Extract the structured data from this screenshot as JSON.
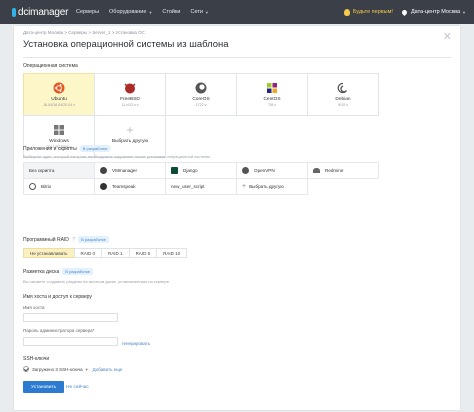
{
  "topbar": {
    "logo_text": "dcimanager",
    "nav": [
      {
        "label": "Серверы",
        "caret": false
      },
      {
        "label": "Оборудование",
        "caret": true
      },
      {
        "label": "Стойки",
        "caret": false
      },
      {
        "label": "Сети",
        "caret": true
      }
    ],
    "wishes_label": "Будьте первым!",
    "datacenter_label": "Дата-центр Москва",
    "colors": {
      "bg": "#3a3f48",
      "accent": "#2fb4e9",
      "wish": "#f7c948"
    }
  },
  "page": {
    "breadcrumb": "Дата-центр Москва  >  Серверы  >  Server_1  >  Установка ОС",
    "title": "Установка операционной системы из шаблона"
  },
  "os_section": {
    "label": "Операционная система",
    "items": [
      {
        "name": "Ubuntu",
        "version": "16.04/18.04/20.04 v",
        "icon": "ubuntu-icon",
        "selected": true
      },
      {
        "name": "FreeBSD",
        "version": "11.x/12.x v",
        "icon": "freebsd-icon",
        "selected": false
      },
      {
        "name": "CoreOS",
        "version": "1722 v",
        "icon": "coreos-icon",
        "selected": false
      },
      {
        "name": "CentOS",
        "version": "7/8 v",
        "icon": "centos-icon",
        "selected": false
      },
      {
        "name": "Debian",
        "version": "9/10 v",
        "icon": "debian-icon",
        "selected": false
      },
      {
        "name": "Windows",
        "version": "2012 R2 RUS v",
        "icon": "windows-icon",
        "selected": false
      },
      {
        "name": "Выбрать другую",
        "version": "",
        "icon": "plus-icon",
        "selected": false
      }
    ]
  },
  "apps_section": {
    "label": "Приложения и скрипты",
    "badge": "В разработке",
    "hint": "Выберите один, который настроит необходимое окружение после установки операционной системы.",
    "items": [
      {
        "name": "Без скрипта",
        "icon": "no-script-icon",
        "selected": true
      },
      {
        "name": "VMmanager",
        "icon": "vmmanager-icon",
        "selected": false
      },
      {
        "name": "Django",
        "icon": "django-icon",
        "selected": false
      },
      {
        "name": "OpenVPN",
        "icon": "openvpn-icon",
        "selected": false
      },
      {
        "name": "Redmine",
        "icon": "redmine-icon",
        "selected": false
      },
      {
        "name": "Bitrix",
        "icon": "bitrix-icon",
        "selected": false
      },
      {
        "name": "Teamspeak",
        "icon": "teamspeak-icon",
        "selected": false
      },
      {
        "name": "new_user_script",
        "icon": "",
        "selected": false
      },
      {
        "name": "Выбрать другую",
        "icon": "plus-icon",
        "selected": false
      }
    ]
  },
  "raid_section": {
    "label": "Программный RAID",
    "badge": "В разработке",
    "options": [
      "Не устанавливать",
      "RAID 0",
      "RAID 1",
      "RAID 5",
      "RAID 10"
    ],
    "selected": "Не устанавливать"
  },
  "disk_section": {
    "label": "Разметка диска",
    "badge": "В разработке",
    "hint": "Вы сможете создавать разделы на жестком диске, установленным на сервере."
  },
  "host_section": {
    "label": "Имя хоста и доступ к серверу",
    "hostname_label": "Имя хоста",
    "hostname_value": "",
    "password_label": "Пароль администратора сервера*",
    "password_value": "",
    "generate_label": "генерировать"
  },
  "ssh_section": {
    "label": "SSH-ключи",
    "loaded_text": "Загружено 3 SSH-ключа",
    "add_link": "Добавить еще"
  },
  "actions": {
    "install_label": "Установить",
    "cancel_label": "Не сейчас"
  }
}
